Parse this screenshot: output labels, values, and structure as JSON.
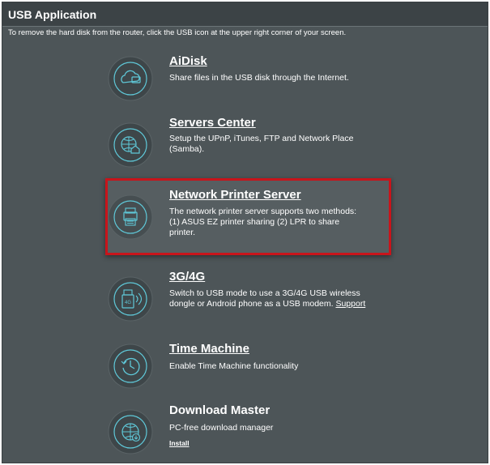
{
  "header": {
    "title": "USB Application",
    "subtitle": "To remove the hard disk from the router, click the USB icon at the upper right corner of your screen."
  },
  "apps": {
    "aidisk": {
      "title": "AiDisk",
      "description": "Share files in the USB disk through the Internet.",
      "icon": "cloud-disk-icon"
    },
    "servers_center": {
      "title": "Servers Center",
      "description_line1": "Setup the UPnP, iTunes, FTP and Network Place",
      "description_line2": "(Samba).",
      "icon": "globe-house-icon"
    },
    "network_printer": {
      "title": "Network Printer Server",
      "description_line1": "The network printer server supports two methods:",
      "description_line2": "(1) ASUS EZ printer sharing (2) LPR to share",
      "description_line3": "printer.",
      "icon": "printer-icon"
    },
    "three_g": {
      "title": "3G/4G",
      "description_line1": "Switch to USB mode to use a 3G/4G USB wireless",
      "description_line2": "dongle or Android phone as a USB modem.",
      "support_link": "Support",
      "icon": "usb-dongle-icon"
    },
    "time_machine": {
      "title": "Time Machine",
      "description": "Enable Time Machine functionality",
      "icon": "clock-icon"
    },
    "download_master": {
      "title": "Download Master",
      "description": "PC-free download manager",
      "install_link": "Install",
      "icon": "globe-download-icon"
    }
  },
  "colors": {
    "panel_bg": "#4d5558",
    "header_bg": "#3c4346",
    "accent": "#5fc8d8",
    "highlight_border": "#c8141b"
  }
}
